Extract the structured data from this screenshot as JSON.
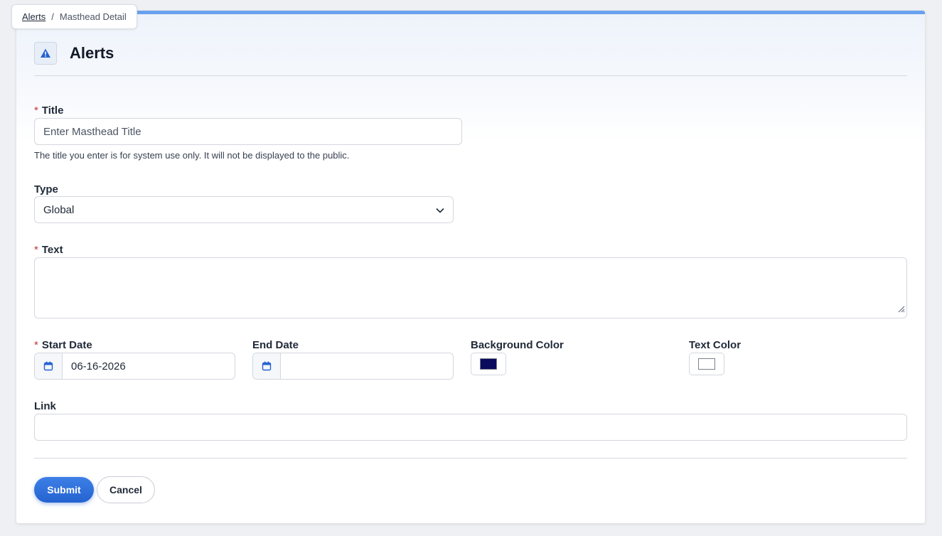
{
  "breadcrumb": {
    "link": "Alerts",
    "separator": "/",
    "current": "Masthead Detail"
  },
  "header": {
    "icon": "warning-triangle-icon",
    "title": "Alerts"
  },
  "form": {
    "title_label": "Title",
    "title_placeholder": "Enter Masthead Title",
    "title_value": "",
    "title_help": "The title you enter is for system use only. It will not be displayed to the public.",
    "type_label": "Type",
    "type_value": "Global",
    "text_label": "Text",
    "text_value": "",
    "start_date_label": "Start Date",
    "start_date_value": "06-16-2026",
    "end_date_label": "End Date",
    "end_date_value": "",
    "bg_color_label": "Background Color",
    "bg_color_value": "#0a0a5e",
    "text_color_label": "Text Color",
    "text_color_value": "#ffffff",
    "link_label": "Link",
    "link_value": "",
    "required_marker": "*"
  },
  "actions": {
    "submit_label": "Submit",
    "cancel_label": "Cancel"
  },
  "colors": {
    "accent": "#2563d0",
    "required": "#c43434",
    "top_bar": "#6aa1ee"
  }
}
